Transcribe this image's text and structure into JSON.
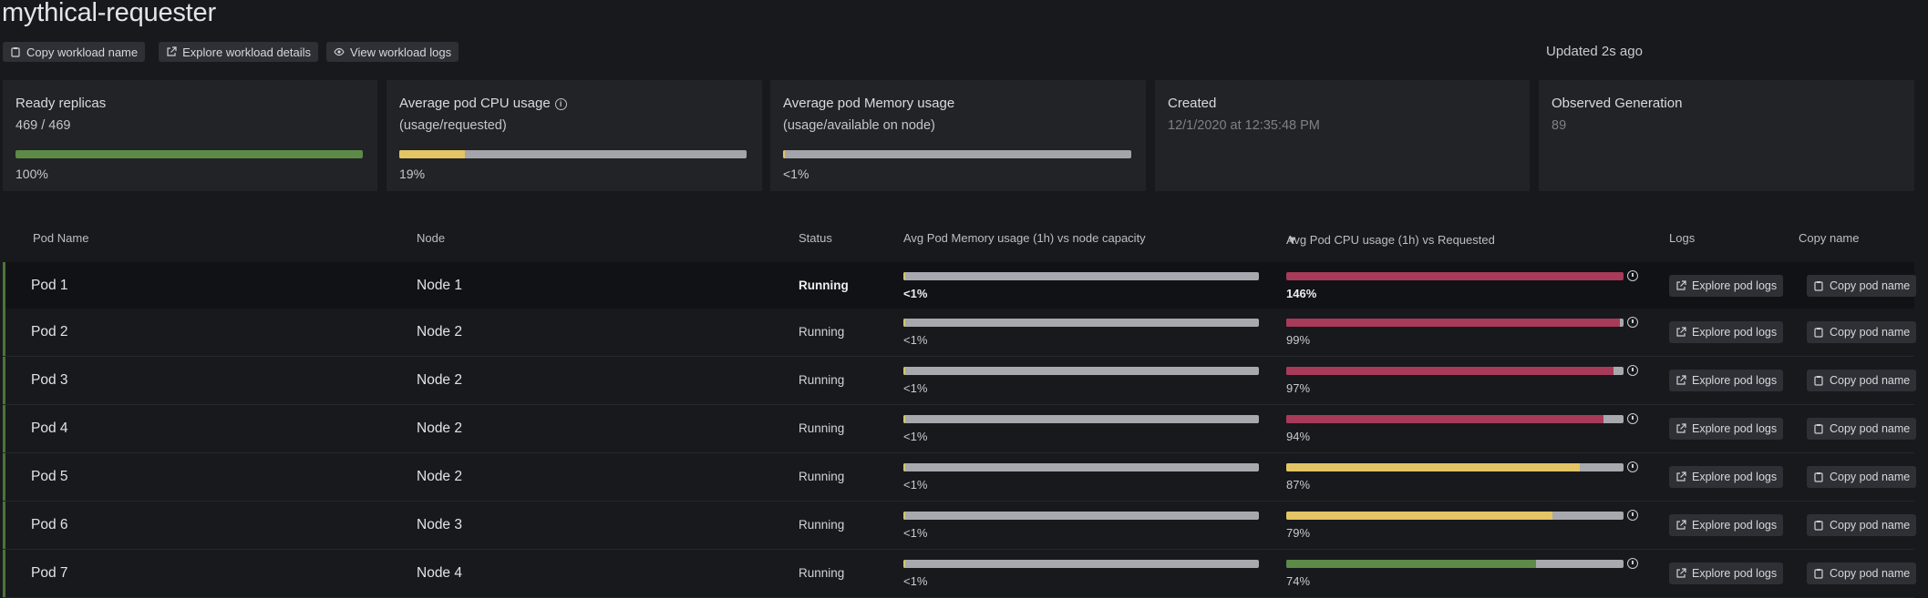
{
  "header": {
    "title": "mythical-requester",
    "buttons": {
      "copy_workload": "Copy workload name",
      "explore_workload": "Explore workload details",
      "view_logs": "View workload logs"
    },
    "updated": "Updated 2s ago"
  },
  "cards": {
    "replicas": {
      "title": "Ready replicas",
      "value": "469 / 469",
      "pct_label": "100%",
      "fraction": 1.0,
      "color": "#5d8a46"
    },
    "cpu": {
      "title": "Average pod CPU usage",
      "subtitle": "(usage/requested)",
      "pct_label": "19%",
      "fraction": 0.19,
      "color": "#e3c565"
    },
    "memory": {
      "title": "Average pod Memory usage",
      "subtitle": "(usage/available on node)",
      "pct_label": "<1%",
      "fraction": 0.004,
      "color": "#e3c565"
    },
    "created": {
      "title": "Created",
      "value": "12/1/2020 at 12:35:48 PM"
    },
    "generation": {
      "title": "Observed Generation",
      "value": "89"
    }
  },
  "table": {
    "columns": {
      "pod": "Pod Name",
      "node": "Node",
      "status": "Status",
      "memory": "Avg Pod Memory usage (1h) vs node capacity",
      "cpu": "Avg Pod CPU usage (1h) vs Requested",
      "logs": "Logs",
      "copy": "Copy name"
    },
    "sort_indicator": "▼",
    "logs_button": "Explore pod logs",
    "copy_button": "Copy pod name",
    "rows": [
      {
        "pod": "Pod 1",
        "node": "Node 1",
        "status": "Running",
        "mem_label": "<1%",
        "mem_fraction": 0.004,
        "cpu_label": "146%",
        "cpu_fraction": 1.0,
        "cpu_color": "#a83a5a"
      },
      {
        "pod": "Pod 2",
        "node": "Node 2",
        "status": "Running",
        "mem_label": "<1%",
        "mem_fraction": 0.004,
        "cpu_label": "99%",
        "cpu_fraction": 0.99,
        "cpu_color": "#a83a5a"
      },
      {
        "pod": "Pod 3",
        "node": "Node 2",
        "status": "Running",
        "mem_label": "<1%",
        "mem_fraction": 0.004,
        "cpu_label": "97%",
        "cpu_fraction": 0.97,
        "cpu_color": "#a83a5a"
      },
      {
        "pod": "Pod 4",
        "node": "Node 2",
        "status": "Running",
        "mem_label": "<1%",
        "mem_fraction": 0.004,
        "cpu_label": "94%",
        "cpu_fraction": 0.94,
        "cpu_color": "#a83a5a"
      },
      {
        "pod": "Pod 5",
        "node": "Node 2",
        "status": "Running",
        "mem_label": "<1%",
        "mem_fraction": 0.004,
        "cpu_label": "87%",
        "cpu_fraction": 0.87,
        "cpu_color": "#e3c565"
      },
      {
        "pod": "Pod 6",
        "node": "Node 3",
        "status": "Running",
        "mem_label": "<1%",
        "mem_fraction": 0.004,
        "cpu_label": "79%",
        "cpu_fraction": 0.79,
        "cpu_color": "#e3c565"
      },
      {
        "pod": "Pod 7",
        "node": "Node 4",
        "status": "Running",
        "mem_label": "<1%",
        "mem_fraction": 0.004,
        "cpu_label": "74%",
        "cpu_fraction": 0.74,
        "cpu_color": "#5d8a46"
      }
    ]
  }
}
